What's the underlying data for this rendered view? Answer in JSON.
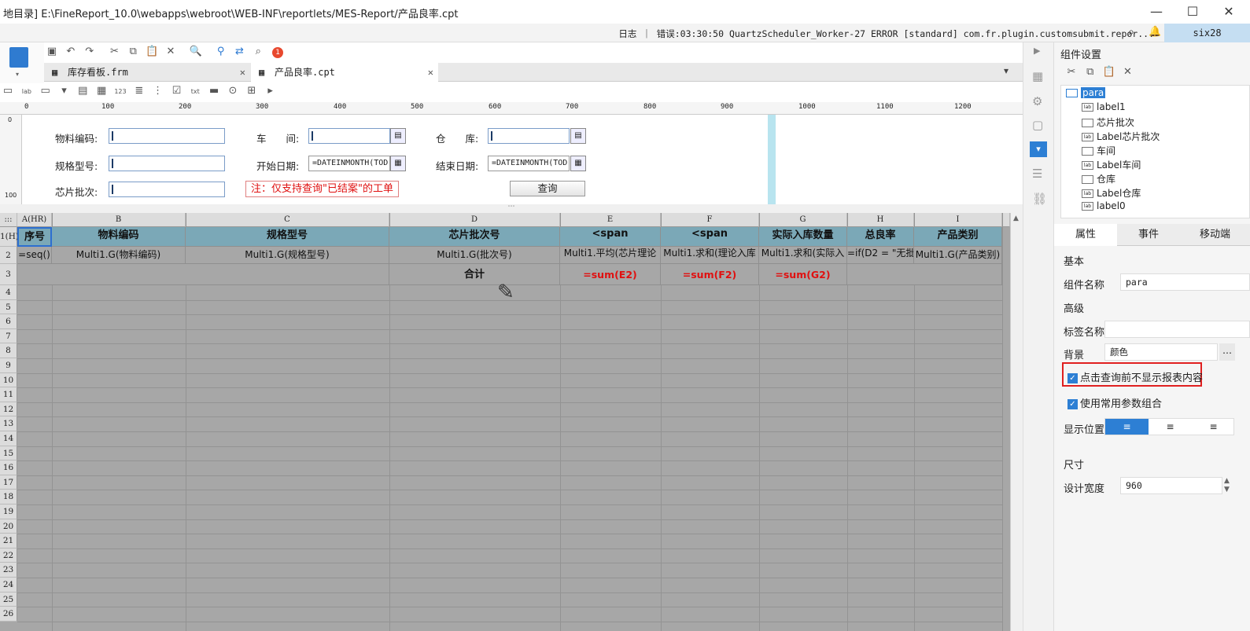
{
  "window": {
    "title": "地目录]    E:\\FineReport_10.0\\webapps\\webroot\\WEB-INF\\reportlets/MES-Report/产品良率.cpt",
    "minimize": "—",
    "maximize": "☐",
    "close": "✕"
  },
  "status": {
    "log": "日志 ｜ 错误:03:30:50 QuartzScheduler_Worker-27 ERROR [standard] com.fr.plugin.customsubmit.repor...",
    "user": "six28"
  },
  "tabs": [
    {
      "label": "库存看板.frm",
      "close": "✕"
    },
    {
      "label": "产品良率.cpt",
      "close": "✕"
    }
  ],
  "notification_count": "1",
  "ruler": [
    "0",
    "100",
    "200",
    "300",
    "400",
    "500",
    "600",
    "700",
    "800",
    "900",
    "1000",
    "1100",
    "1200"
  ],
  "vruler": [
    "0",
    "100"
  ],
  "params": {
    "material_code_label": "物料编码:",
    "spec_label": "规格型号:",
    "chip_batch_label": "芯片批次:",
    "workshop_label": "车　　间:",
    "start_date_label": "开始日期:",
    "warehouse_label": "仓　　库:",
    "end_date_label": "结束日期:",
    "start_date_value": "=DATEINMONTH(TOD:",
    "end_date_value": "=DATEINMONTH(TOD:",
    "note": "注：仅支持查询\"已结案\"的工单",
    "query_button": "查询"
  },
  "grid": {
    "corner": ":::",
    "columns": [
      "A(HR)",
      "B",
      "C",
      "D",
      "E",
      "F",
      "G",
      "H",
      "I"
    ],
    "rows": [
      "1(H)",
      "2",
      "3",
      "4",
      "5",
      "6",
      "7",
      "8",
      "9",
      "10",
      "11",
      "12",
      "13",
      "14",
      "15",
      "16",
      "17",
      "18",
      "19",
      "20",
      "21",
      "22",
      "23",
      "24",
      "25",
      "26"
    ],
    "header_row": [
      "序号",
      "物料编码",
      "规格型号",
      "芯片批次号",
      "<span",
      "<span",
      "实际入库数量",
      "总良率",
      "产品类别"
    ],
    "data_row": [
      "=seq()",
      "Multi1.G(物料编码)",
      "Multi1.G(规格型号)",
      "Multi1.G(批次号)",
      "Multi1.平均(芯片理论",
      "Multi1.求和(理论入库",
      "Multi1.求和(实际入",
      "=if(D2 = \"无批",
      "Multi1.G(产品类别)"
    ],
    "total_row": {
      "label": "合计",
      "e": "=sum(E2)",
      "f": "=sum(F2)",
      "g": "=sum(G2)"
    }
  },
  "right_panel": {
    "title": "组件设置",
    "tree": [
      "para",
      "label1",
      "芯片批次",
      "Label芯片批次",
      "车间",
      "Label车间",
      "仓库",
      "Label仓库",
      "label0"
    ],
    "tabs": [
      "属性",
      "事件",
      "移动端"
    ],
    "basic_label": "基本",
    "component_name_label": "组件名称",
    "component_name_value": "para",
    "advanced_label": "高级",
    "tag_name_label": "标签名称",
    "tag_name_value": "",
    "background_label": "背景",
    "background_value": "颜色",
    "hide_before_query": "点击查询前不显示报表内容",
    "use_common_params": "使用常用参数组合",
    "display_position_label": "显示位置",
    "size_label": "尺寸",
    "design_width_label": "设计宽度",
    "design_width_value": "960"
  },
  "colors": {
    "header_cell": "#7ba8b7",
    "grid_bg": "#a7a7a7",
    "formula_red": "#e01010",
    "highlight_box": "#e02020"
  }
}
